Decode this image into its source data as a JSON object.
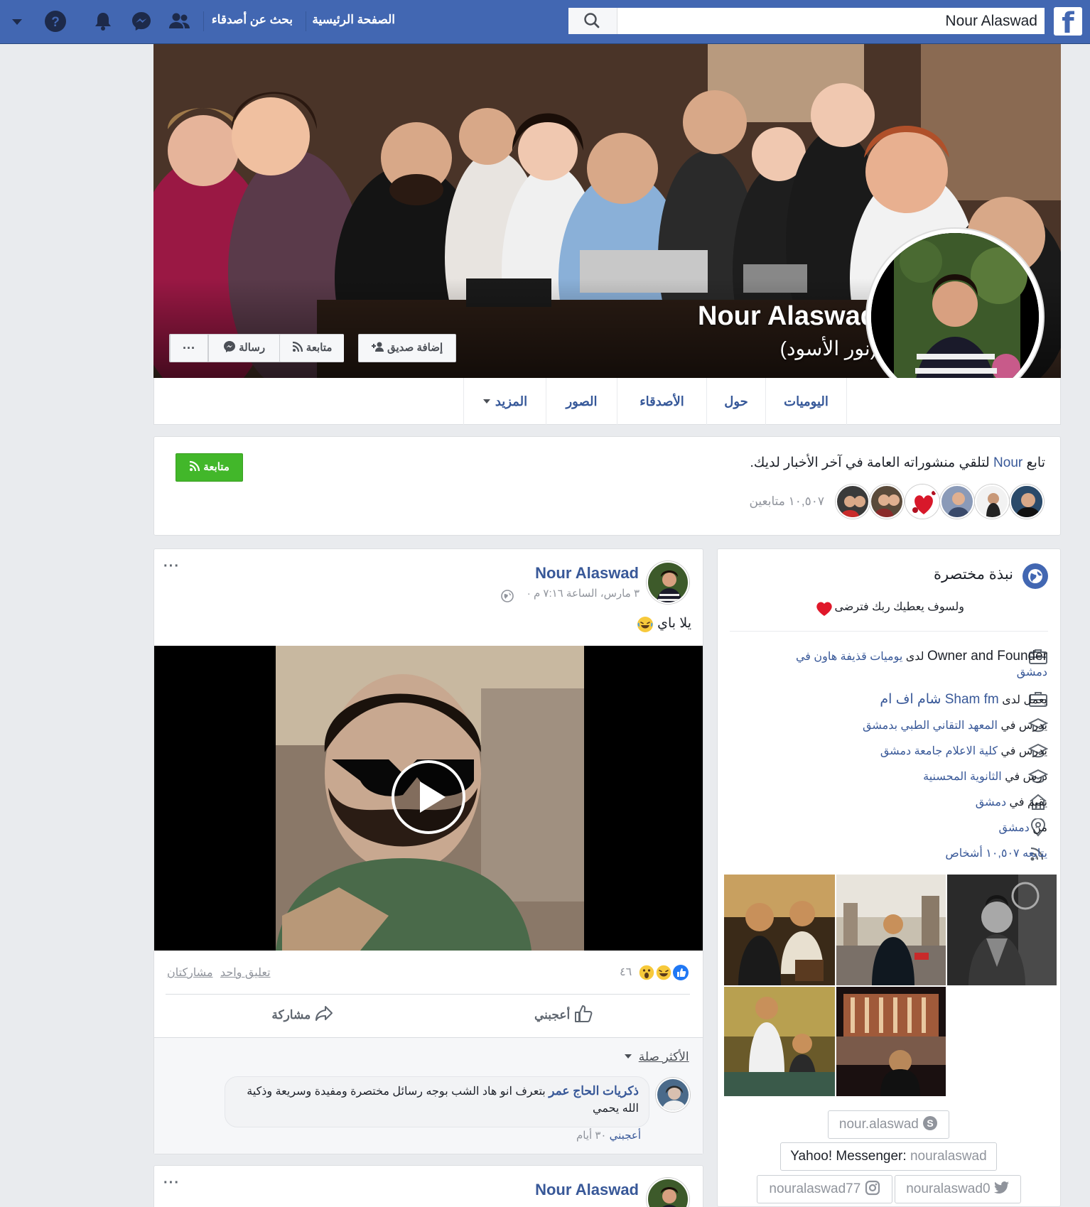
{
  "topbar": {
    "search_value": "Nour Alaswad",
    "nav_home": "الصفحة الرئيسية",
    "nav_find_friends": "بحث عن أصدقاء",
    "icons": [
      "facebook-logo-icon",
      "search-icon",
      "friends-icon",
      "messenger-icon",
      "bell-icon",
      "help-icon",
      "dropdown-icon"
    ],
    "brand_color": "#4267b2"
  },
  "cover": {
    "name": "Nour Alaswad",
    "alt_name": "(نور الأسود)",
    "add_friend": "إضافة صديق",
    "follow": "متابعة",
    "message": "رسالة",
    "more": "···"
  },
  "tabs": {
    "timeline": "اليوميات",
    "about": "حول",
    "friends": "الأصدقاء",
    "photos": "الصور",
    "more": "المزيد"
  },
  "follow_box": {
    "prefix": "تابع",
    "name": "Nour",
    "suffix": "لتلقي منشوراته العامة في آخر الأخبار لديك.",
    "button": "متابعة",
    "followers": "١٠,٥٠٧ متابعين",
    "button_color": "#42b72a"
  },
  "intro": {
    "title": "نبذة مختصرة",
    "bio": "ولسوف يعطيك ربك فترضى",
    "work1_role": "Owner and Founder",
    "work1_mid": "لدى",
    "work1_place": "يوميات قذيفة هاون في دمشق",
    "work2_pre": "يعمل لدى",
    "work2_place": "Sham fm شام اف ام",
    "edu1_pre": "يدرس في",
    "edu1_place": "المعهد التقاني الطبي بدمشق",
    "edu2_pre": "يدرس في",
    "edu2_place": "كلية الاعلام جامعة دمشق",
    "edu3_pre": "درس في",
    "edu3_place": "الثانوية المحسنية",
    "lives_pre": "يقيم في",
    "lives_place": "دمشق",
    "from_pre": "من",
    "from_place": "دمشق",
    "followed_by": "يتابعه ١٠,٥٠٧ أشخاص",
    "skype": "nour.alaswad",
    "yahoo_label": "Yahoo! Messenger:",
    "yahoo": "nouralaswad",
    "instagram": "nouralaswad77",
    "twitter": "nouralaswad0"
  },
  "post": {
    "author": "Nour Alaswad",
    "time": "٣ مارس، الساعة ٧:١٦ م ·",
    "text": "يلا باي",
    "reaction_count": "٤٦",
    "comments": "تعليق واحد",
    "shares": "مشاركتان",
    "like": "أعجبني",
    "share": "مشاركة",
    "sort": "الأكثر صلة",
    "comment_author": "ذكريات الحاج عمر",
    "comment_text_1": "بتعرف انو هاد الشب بوجه رسائل مختصرة ومفيدة وسريعة وذكية",
    "comment_text_2": "الله يحمي",
    "comment_like": "أعجبني",
    "comment_time": "٣٠ أيام",
    "more": "···"
  },
  "post2": {
    "author": "Nour Alaswad",
    "more": "···"
  }
}
